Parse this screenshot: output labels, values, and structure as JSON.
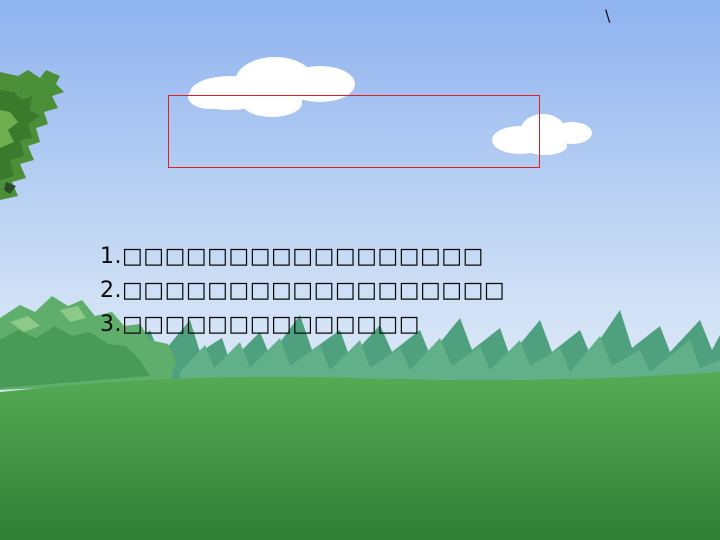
{
  "slide": {
    "corner_mark": "\\",
    "items": [
      "1.□□□□□□□□□□□□□□□□□",
      "2.□□□□□□□□□□□□□□□□□□",
      "3.□□□□□□□□□□□□□□"
    ]
  },
  "colors": {
    "sky_top": "#8fb3ef",
    "sky_bottom": "#f2f7fc",
    "grass": "#4ea14f",
    "grass_dark": "#2f7a36",
    "bush": "#5fae6b",
    "tree": "#4c8f39",
    "outline": "#e02020"
  }
}
